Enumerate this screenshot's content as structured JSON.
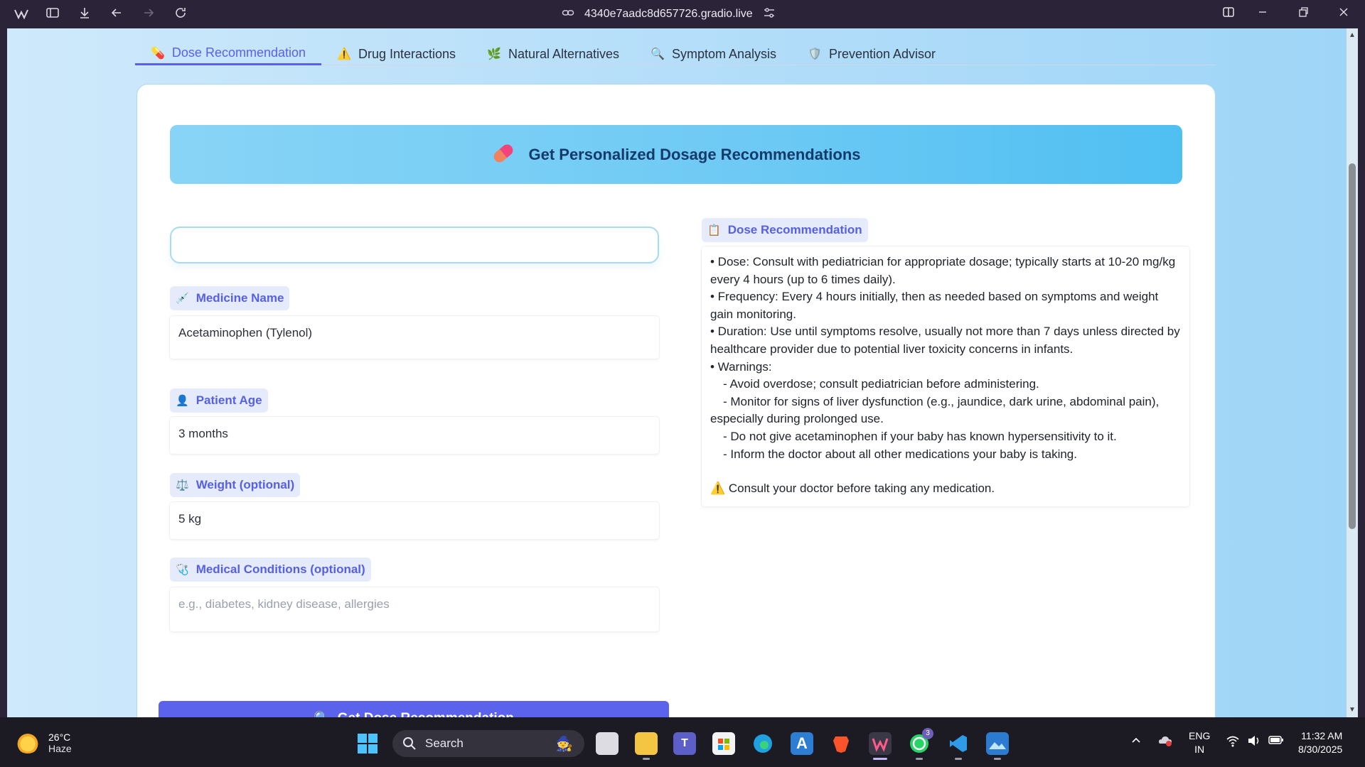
{
  "browser": {
    "url": "4340e7aadc8d657726.gradio.live",
    "icons": [
      "workspace-icon",
      "sidebar-icon",
      "download-icon",
      "back-icon",
      "forward-icon",
      "reload-icon",
      "link-icon",
      "site-settings-icon"
    ],
    "window_controls": [
      "split-view-icon",
      "minimize-icon",
      "restore-icon",
      "close-icon"
    ]
  },
  "tabs": [
    {
      "icon": "pill-icon",
      "glyph": "💊",
      "label": "Dose Recommendation",
      "active": true
    },
    {
      "icon": "warning-icon",
      "glyph": "⚠️",
      "label": "Drug Interactions",
      "active": false
    },
    {
      "icon": "herb-icon",
      "glyph": "🌿",
      "label": "Natural Alternatives",
      "active": false
    },
    {
      "icon": "magnifier-icon",
      "glyph": "🔍",
      "label": "Symptom Analysis",
      "active": false
    },
    {
      "icon": "shield-icon",
      "glyph": "🛡️",
      "label": "Prevention Advisor",
      "active": false
    }
  ],
  "banner": {
    "title": "Get Personalized Dosage Recommendations"
  },
  "form": {
    "medicine": {
      "label": "Medicine Name",
      "glyph": "💉",
      "value": "Acetaminophen (Tylenol)"
    },
    "age": {
      "label": "Patient Age",
      "glyph": "👤",
      "value": "3 months"
    },
    "weight": {
      "label": "Weight (optional)",
      "glyph": "⚖️",
      "value": "5 kg"
    },
    "conditions": {
      "label": "Medical Conditions (optional)",
      "glyph": "🩺",
      "placeholder": "e.g., diabetes, kidney disease, allergies"
    },
    "submit": {
      "label": "Get Dose Recommendation",
      "glyph": "🔍"
    }
  },
  "output": {
    "label": "Dose Recommendation",
    "glyph": "📋",
    "line1": "• Dose: Consult with pediatrician for appropriate dosage; typically starts at 10-20 mg/kg every 4 hours (up to 6 times daily).",
    "line2": "• Frequency: Every 4 hours initially, then as needed based on symptoms and weight gain monitoring.",
    "line3": "• Duration: Use until symptoms resolve, usually not more than 7 days unless directed by healthcare provider due to potential liver toxicity concerns in infants.",
    "line4": "• Warnings:",
    "warn1": "- Avoid overdose; consult pediatrician before administering.",
    "warn2": "- Monitor for signs of liver dysfunction (e.g., jaundice, dark urine, abdominal pain), especially during prolonged use.",
    "warn3": "- Do not give acetaminophen if your baby has known hypersensitivity to it.",
    "warn4": "- Inform the doctor about all other medications your baby is taking.",
    "disclaimer": "⚠️ Consult your doctor before taking any medication."
  },
  "taskbar": {
    "temp": "26°C",
    "condition": "Haze",
    "search_label": "Search",
    "lang_top": "ENG",
    "lang_bottom": "IN",
    "time": "11:32 AM",
    "date": "8/30/2025",
    "whatsapp_badge": "3"
  }
}
